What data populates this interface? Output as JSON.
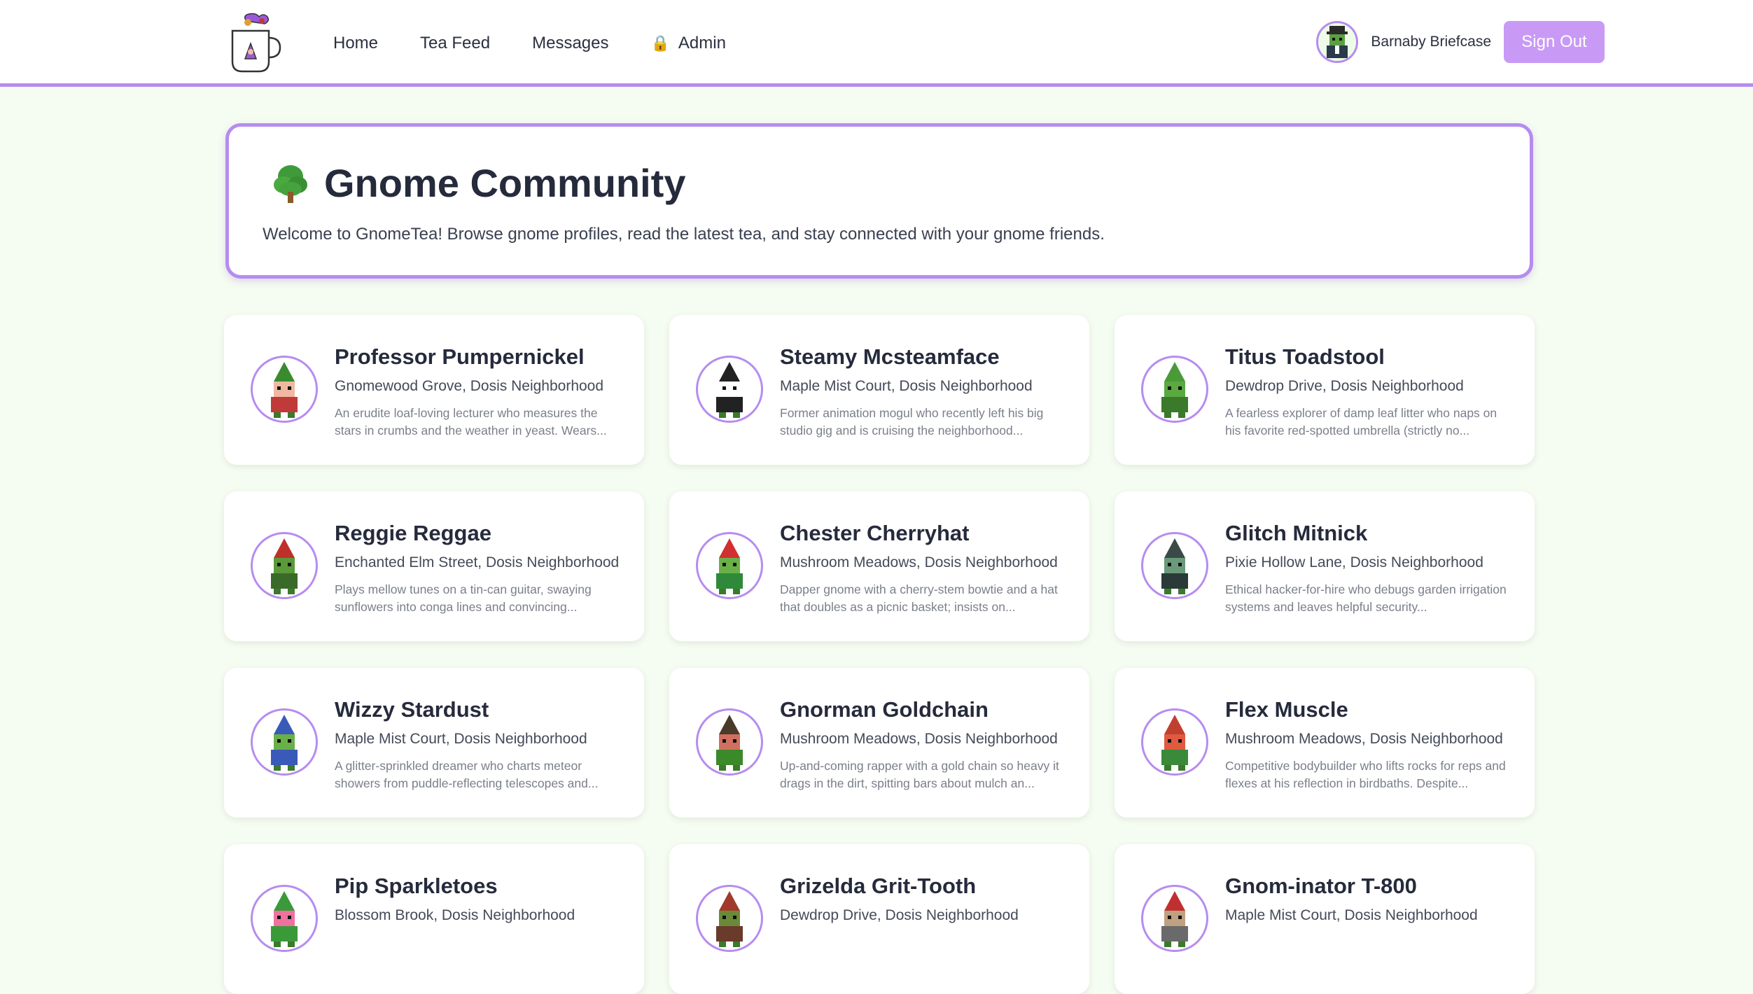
{
  "nav": {
    "items": [
      {
        "label": "Home"
      },
      {
        "label": "Tea Feed"
      },
      {
        "label": "Messages"
      },
      {
        "label": "Admin",
        "icon": "lock-icon"
      }
    ]
  },
  "user": {
    "name": "Barnaby Briefcase",
    "sign_out_label": "Sign Out"
  },
  "hero": {
    "title": "Gnome Community",
    "icon": "tree-icon",
    "description": "Welcome to GnomeTea! Browse gnome profiles, read the latest tea, and stay connected with your gnome friends."
  },
  "colors": {
    "accent": "#b68cf0",
    "button": "#c89af5",
    "background": "#f5fcf1"
  },
  "profiles": [
    {
      "name": "Professor Pumpernickel",
      "location": "Gnomewood Grove, Dosis Neighborhood",
      "bio": "An erudite loaf-loving lecturer who measures the stars in crumbs and the weather in yeast. Wears...",
      "hat": "#3a8a2e",
      "skin": "#f0b8a0",
      "body": "#c03a3a"
    },
    {
      "name": "Steamy Mcsteamface",
      "location": "Maple Mist Court, Dosis Neighborhood",
      "bio": "Former animation mogul who recently left his big studio gig and is cruising the neighborhood...",
      "hat": "#222222",
      "skin": "#ffffff",
      "body": "#222222"
    },
    {
      "name": "Titus Toadstool",
      "location": "Dewdrop Drive, Dosis Neighborhood",
      "bio": "A fearless explorer of damp leaf litter who naps on his favorite red-spotted umbrella (strictly no...",
      "hat": "#4a9a3a",
      "skin": "#5aaa40",
      "body": "#3a7a2a"
    },
    {
      "name": "Reggie Reggae",
      "location": "Enchanted Elm Street, Dosis Neighborhood",
      "bio": "Plays mellow tunes on a tin-can guitar, swaying sunflowers into conga lines and convincing...",
      "hat": "#c0302a",
      "skin": "#5a9a38",
      "body": "#3a6a2a"
    },
    {
      "name": "Chester Cherryhat",
      "location": "Mushroom Meadows, Dosis Neighborhood",
      "bio": "Dapper gnome with a cherry-stem bowtie and a hat that doubles as a picnic basket; insists on...",
      "hat": "#d03030",
      "skin": "#6ab048",
      "body": "#2e8a3a"
    },
    {
      "name": "Glitch Mitnick",
      "location": "Pixie Hollow Lane, Dosis Neighborhood",
      "bio": "Ethical hacker-for-hire who debugs garden irrigation systems and leaves helpful security...",
      "hat": "#3a4a48",
      "skin": "#6a9a7a",
      "body": "#2a3a38"
    },
    {
      "name": "Wizzy Stardust",
      "location": "Maple Mist Court, Dosis Neighborhood",
      "bio": "A glitter-sprinkled dreamer who charts meteor showers from puddle-reflecting telescopes and...",
      "hat": "#3a5aba",
      "skin": "#6ab048",
      "body": "#3a5aba"
    },
    {
      "name": "Gnorman Goldchain",
      "location": "Mushroom Meadows, Dosis Neighborhood",
      "bio": "Up-and-coming rapper with a gold chain so heavy it drags in the dirt, spitting bars about mulch an...",
      "hat": "#4a3a2a",
      "skin": "#d07060",
      "body": "#3a8a2a"
    },
    {
      "name": "Flex Muscle",
      "location": "Mushroom Meadows, Dosis Neighborhood",
      "bio": "Competitive bodybuilder who lifts rocks for reps and flexes at his reflection in birdbaths. Despite...",
      "hat": "#c04030",
      "skin": "#e05a40",
      "body": "#3a8a3a"
    },
    {
      "name": "Pip Sparkletoes",
      "location": "Blossom Brook, Dosis Neighborhood",
      "bio": "",
      "hat": "#3a9a3a",
      "skin": "#f070a0",
      "body": "#3a9a3a"
    },
    {
      "name": "Grizelda Grit-Tooth",
      "location": "Dewdrop Drive, Dosis Neighborhood",
      "bio": "",
      "hat": "#a03a2a",
      "skin": "#6a8a3a",
      "body": "#6a3a2a"
    },
    {
      "name": "Gnom-inator T-800",
      "location": "Maple Mist Court, Dosis Neighborhood",
      "bio": "",
      "hat": "#c03030",
      "skin": "#c0a080",
      "body": "#6a6a6a"
    }
  ]
}
